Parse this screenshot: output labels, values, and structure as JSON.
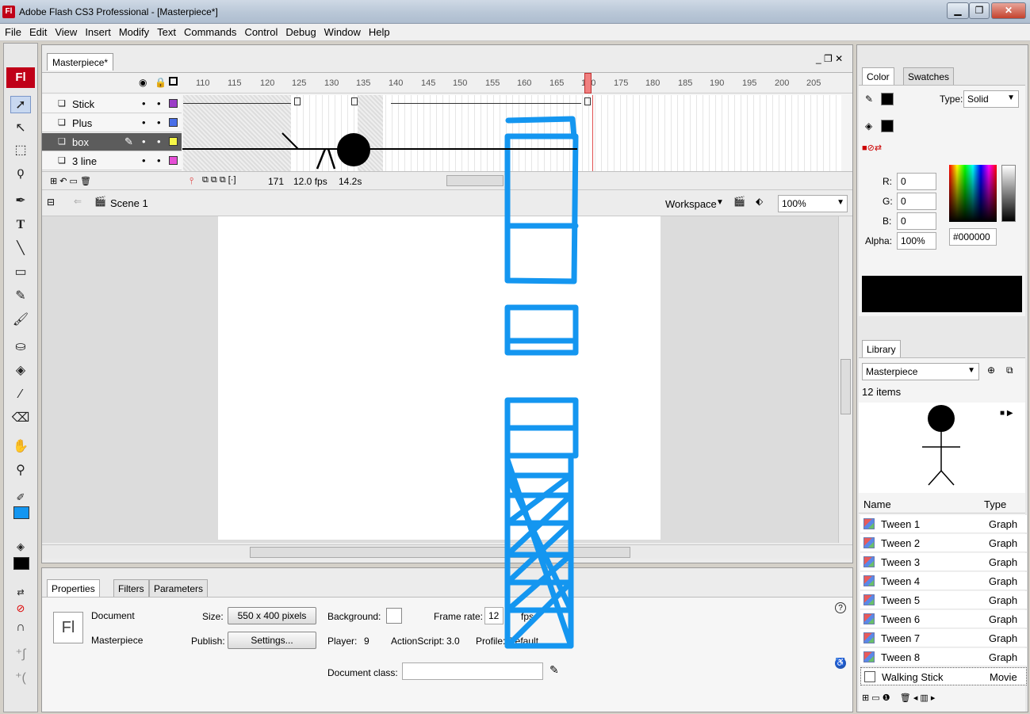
{
  "window": {
    "app_icon": "Fl",
    "title": "Adobe Flash CS3 Professional - [Masterpiece*]",
    "min": "▁",
    "max": "❐",
    "close": "✕"
  },
  "menu": [
    "File",
    "Edit",
    "View",
    "Insert",
    "Modify",
    "Text",
    "Commands",
    "Control",
    "Debug",
    "Window",
    "Help"
  ],
  "document_tab": "Masterpiece*",
  "timeline": {
    "frame_numbers": [
      "110",
      "115",
      "120",
      "125",
      "130",
      "135",
      "140",
      "145",
      "150",
      "155",
      "160",
      "165",
      "170",
      "175",
      "180",
      "185",
      "190",
      "195",
      "200",
      "205"
    ],
    "layers": [
      {
        "name": "Stick",
        "color": "#9b3ec7"
      },
      {
        "name": "Plus",
        "color": "#4a6fe8"
      },
      {
        "name": "box",
        "color": "#f7f747",
        "selected": true
      },
      {
        "name": "3 line",
        "color": "#e64fd6"
      }
    ],
    "current_frame": "171",
    "fps": "12.0 fps",
    "time": "14.2s"
  },
  "scene": {
    "name": "Scene 1",
    "workspace": "Workspace",
    "zoom": "100%"
  },
  "properties": {
    "tabs": [
      "Properties",
      "Filters",
      "Parameters"
    ],
    "doc_label": "Document",
    "doc_name": "Masterpiece",
    "icon": "Fl",
    "size_label": "Size:",
    "size_value": "550 x 400 pixels",
    "publish_label": "Publish:",
    "settings_label": "Settings...",
    "background_label": "Background:",
    "frame_rate_label": "Frame rate:",
    "frame_rate_value": "12",
    "fps_unit": "fps",
    "player_label": "Player:",
    "player_value": "9",
    "actionscript_label": "ActionScript:",
    "actionscript_value": "3.0",
    "profile_label": "Profile:",
    "profile_value": "Default",
    "document_class_label": "Document class:"
  },
  "color_panel": {
    "tabs": [
      "Color",
      "Swatches"
    ],
    "type_label": "Type:",
    "type_value": "Solid",
    "r_label": "R:",
    "r_value": "0",
    "g_label": "G:",
    "g_value": "0",
    "b_label": "B:",
    "b_value": "0",
    "alpha_label": "Alpha:",
    "alpha_value": "100%",
    "hex": "#000000"
  },
  "library": {
    "tab": "Library",
    "document": "Masterpiece",
    "count": "12 items",
    "col_name": "Name",
    "col_type": "Type",
    "items": [
      {
        "name": "Tween 1",
        "type": "Graph"
      },
      {
        "name": "Tween 2",
        "type": "Graph"
      },
      {
        "name": "Tween 3",
        "type": "Graph"
      },
      {
        "name": "Tween 4",
        "type": "Graph"
      },
      {
        "name": "Tween 5",
        "type": "Graph"
      },
      {
        "name": "Tween 6",
        "type": "Graph"
      },
      {
        "name": "Tween 7",
        "type": "Graph"
      },
      {
        "name": "Tween 8",
        "type": "Graph"
      },
      {
        "name": "Walking Stick",
        "type": "Movie"
      }
    ]
  },
  "colors": {
    "stroke_color": "#1496f0",
    "selected_layer": "#5c5c5c",
    "playhead": "#e05050"
  }
}
